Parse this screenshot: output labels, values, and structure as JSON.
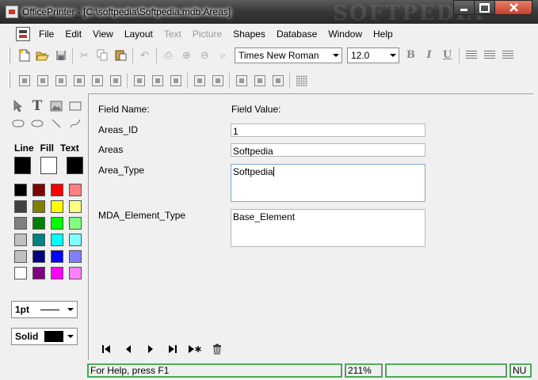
{
  "window": {
    "title": "OfficePrinter - [C:\\softpedia\\Softpedia.mdb:Areas]",
    "watermark": "SOFTPEDIA"
  },
  "menu": {
    "items": [
      {
        "label": "File",
        "disabled": false
      },
      {
        "label": "Edit",
        "disabled": false
      },
      {
        "label": "View",
        "disabled": false
      },
      {
        "label": "Layout",
        "disabled": false
      },
      {
        "label": "Text",
        "disabled": true
      },
      {
        "label": "Picture",
        "disabled": true
      },
      {
        "label": "Shapes",
        "disabled": false
      },
      {
        "label": "Database",
        "disabled": false
      },
      {
        "label": "Window",
        "disabled": false
      },
      {
        "label": "Help",
        "disabled": false
      }
    ]
  },
  "toolbar": {
    "font_name": "Times New Roman",
    "font_size": "12.0",
    "bold": "B",
    "italic": "I",
    "underline": "U"
  },
  "left_panel": {
    "line_label": "Line",
    "fill_label": "Fill",
    "text_label": "Text",
    "line_color": "#000000",
    "fill_color": "#ffffff",
    "text_color": "#000000",
    "palette": [
      "#000000",
      "#800000",
      "#ff0000",
      "#ff8080",
      "#404040",
      "#808000",
      "#ffff00",
      "#ffff80",
      "#808080",
      "#008000",
      "#00ff00",
      "#80ff80",
      "#c0c0c0",
      "#008080",
      "#00ffff",
      "#80ffff",
      "#c0c0c0",
      "#000080",
      "#0000ff",
      "#8080ff",
      "#ffffff",
      "#800080",
      "#ff00ff",
      "#ff80ff"
    ],
    "line_width": "1pt",
    "fill_style": "Solid"
  },
  "form": {
    "field_name_header": "Field Name:",
    "field_value_header": "Field Value:",
    "fields": [
      {
        "name": "Areas_ID",
        "value": "1"
      },
      {
        "name": "Areas",
        "value": "Softpedia"
      },
      {
        "name": "Area_Type",
        "value": "Softpedia"
      },
      {
        "name": "MDA_Element_Type",
        "value": "Base_Element"
      }
    ]
  },
  "status": {
    "help": "For Help, press F1",
    "zoom": "211%",
    "num": "NU"
  }
}
